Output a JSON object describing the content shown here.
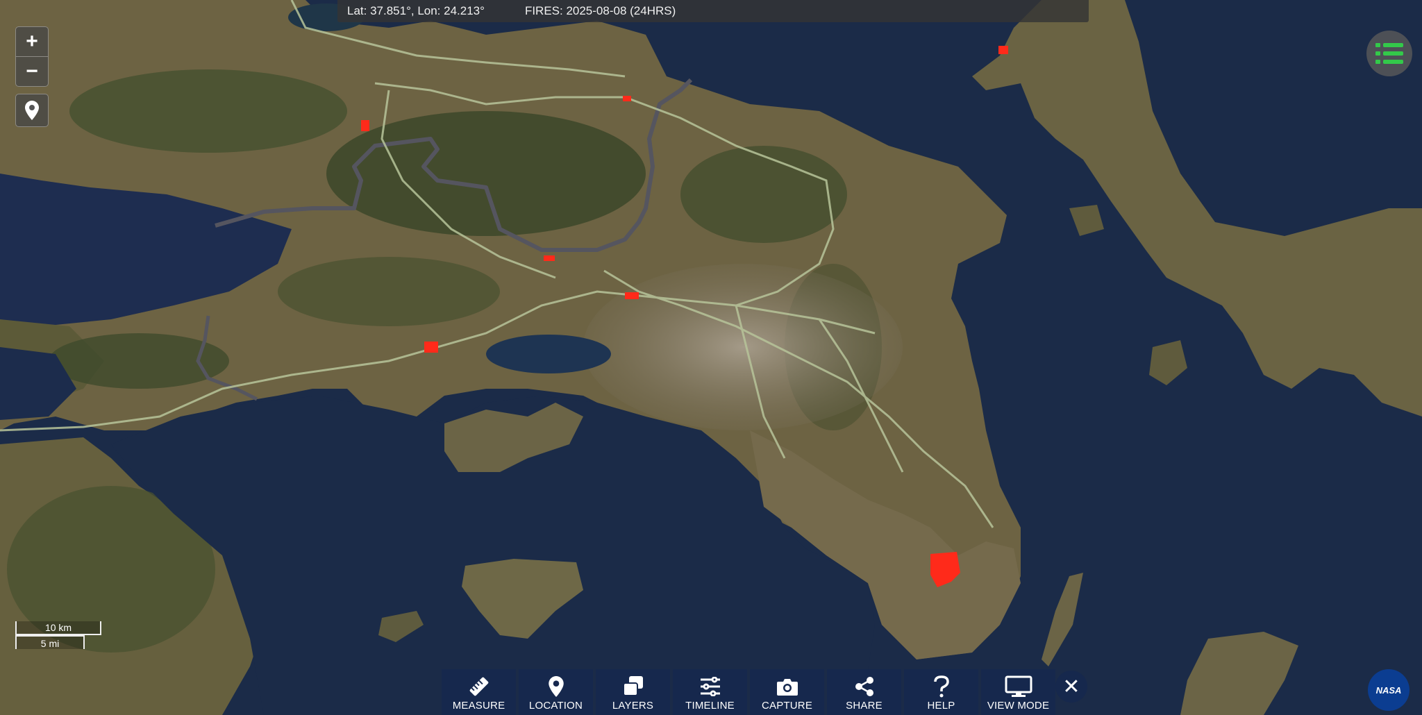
{
  "infobar": {
    "coords": "Lat: 37.851°, Lon: 24.213°",
    "fires": "FIRES: 2025-08-08 (24HRS)"
  },
  "zoom": {
    "in_label": "+",
    "out_label": "−"
  },
  "scale": {
    "km_label": "10 km",
    "mi_label": "5 mi"
  },
  "toolbar": [
    {
      "label": "MEASURE",
      "icon": "ruler-icon"
    },
    {
      "label": "LOCATION",
      "icon": "map-pin-icon"
    },
    {
      "label": "LAYERS",
      "icon": "layers-icon"
    },
    {
      "label": "TIMELINE",
      "icon": "sliders-icon"
    },
    {
      "label": "CAPTURE",
      "icon": "camera-icon"
    },
    {
      "label": "SHARE",
      "icon": "share-icon"
    },
    {
      "label": "HELP",
      "icon": "help-icon"
    },
    {
      "label": "VIEW MODE",
      "icon": "monitor-icon"
    }
  ],
  "close_label": "✕",
  "logo": {
    "text": "NASA"
  },
  "colors": {
    "sea": "#1b2b48",
    "land": "#6f6545",
    "forest": "#3f4a2c",
    "urban": "#8e8474",
    "fire": "#ff2a1a",
    "road": "#b7c49a",
    "border": "#5c5c66",
    "toolbar_bg": "#16284e",
    "list_icon": "#33c94a"
  }
}
